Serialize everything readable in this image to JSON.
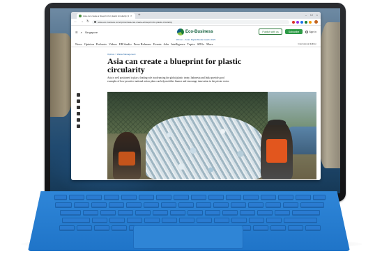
{
  "browser": {
    "tab_title": "Asia can create a blueprint for plastic circularity | Eco-Business",
    "tab_close": "×",
    "new_tab": "+",
    "window_controls": [
      "–",
      "☐",
      "×"
    ],
    "url": "www.eco-business.com/opinion/asia-can-create-a-blueprint-for-plastic-circularity/"
  },
  "site": {
    "region": "Singapore",
    "logo_text": "Eco-Business",
    "publish_button": "Publish with us",
    "subscribe_button": "Subscribe",
    "signin": "Sign in",
    "promo": "Winner – Asian Digital Media Awards 2023",
    "nav": [
      "News",
      "Opinion",
      "Podcasts",
      "Videos",
      "EB Studio",
      "Press Releases",
      "Events",
      "Jobs",
      "Intelligence",
      "Topics",
      "SDGs",
      "More"
    ],
    "international": "International Edition"
  },
  "article": {
    "breadcrumb": "Opinion > Waste Management",
    "headline": "Asia can create a blueprint for plastic circularity",
    "standfirst": "Asia is well positioned to play a leading role in advancing the global plastic treaty. Indonesia and India provide good examples of how proactive national action plans can help mobilise finance and encourage innovation in the private sector."
  },
  "share_icons": [
    "twitter-icon",
    "facebook-icon",
    "linkedin-icon",
    "whatsapp-icon",
    "email-icon",
    "link-icon"
  ]
}
